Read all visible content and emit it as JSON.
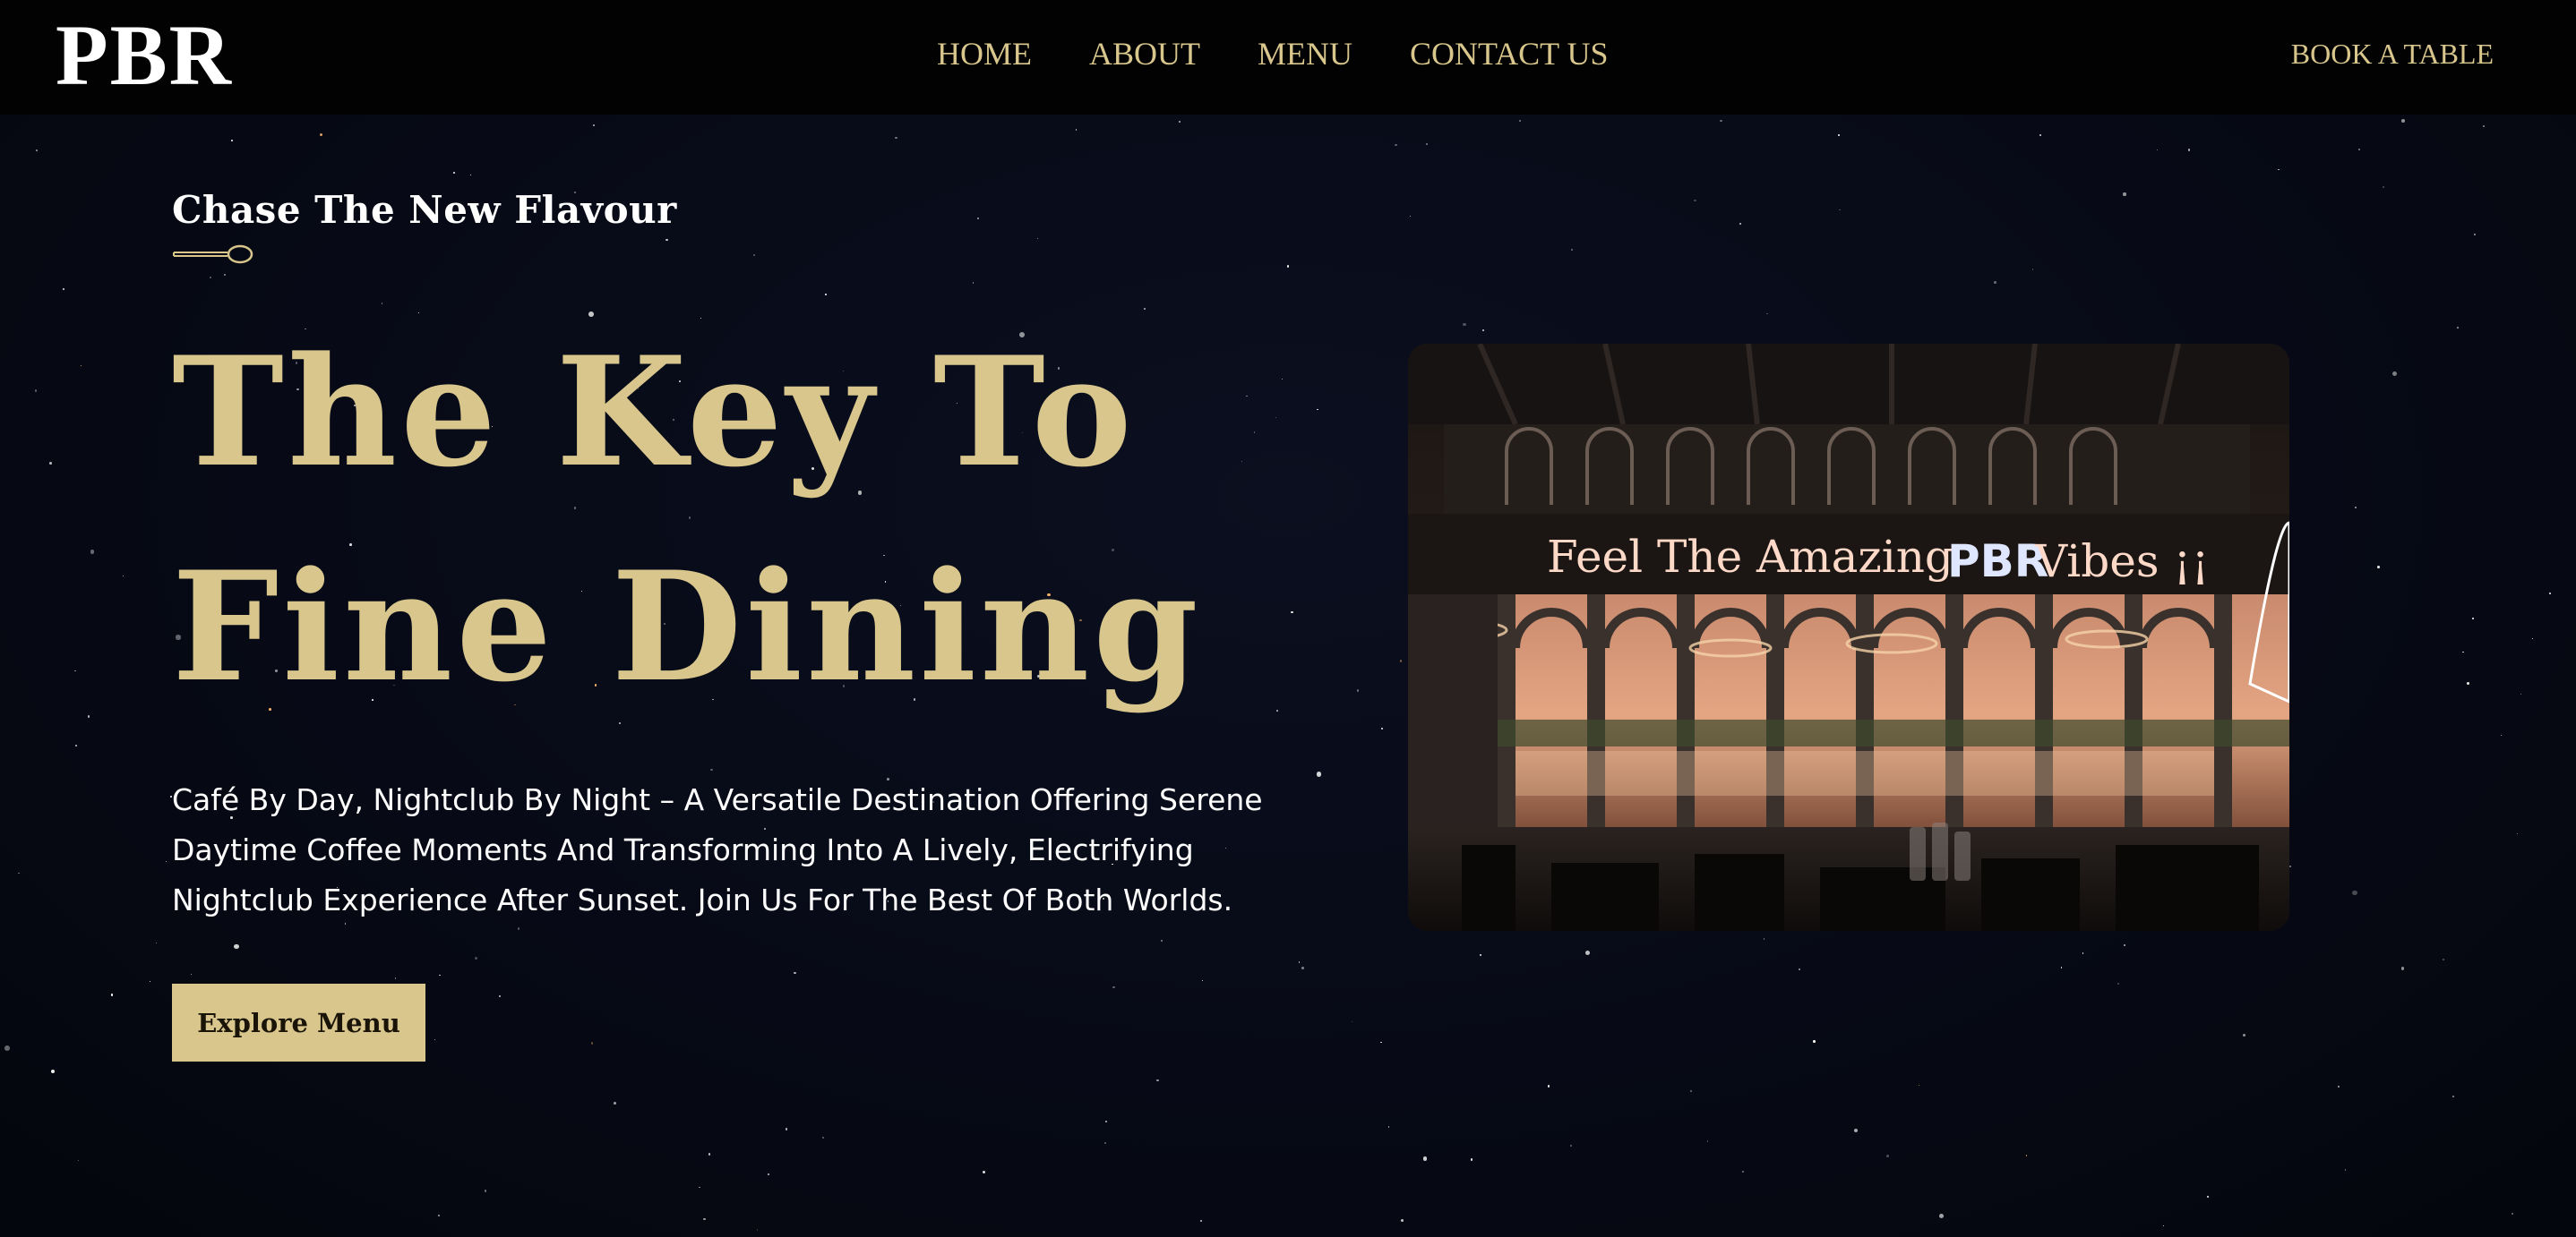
{
  "brand": {
    "logo": "PBR"
  },
  "nav": {
    "items": [
      {
        "label": "HOME"
      },
      {
        "label": "ABOUT"
      },
      {
        "label": "MENU"
      },
      {
        "label": "CONTACT US"
      }
    ],
    "cta_label": "BOOK A TABLE"
  },
  "hero": {
    "eyebrow": "Chase The New Flavour",
    "headline": "The Key To Fine Dining",
    "description": "Café By Day, Nightclub By Night – A Versatile Destination Offering Serene Daytime Coffee Moments And Transforming Into A Lively, Electrifying Nightclub Experience After Sunset. Join Us For The Best Of Both Worlds.",
    "button_label": "Explore Menu",
    "image": {
      "sign_text": "Feel The Amazing",
      "sign_brand": "PBR",
      "sign_tail": "Vibes ¡¡"
    }
  },
  "colors": {
    "background": "#05070f",
    "navbar": "#020202",
    "accent": "#d8c68c",
    "text": "#ffffff"
  },
  "icons": [
    "spoon-icon"
  ]
}
